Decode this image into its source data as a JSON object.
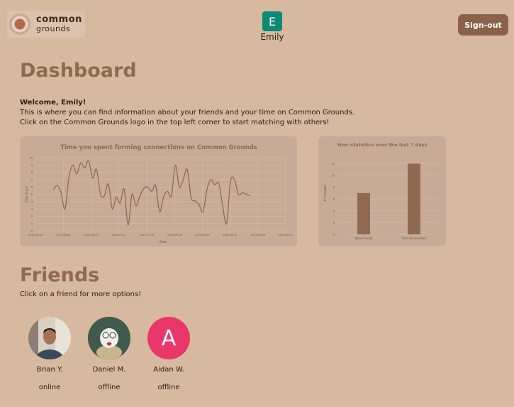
{
  "header": {
    "logo_line1": "common",
    "logo_line2": "grounds",
    "user_initial": "E",
    "user_name": "Emily",
    "signout_label": "Sign-out"
  },
  "dashboard": {
    "title": "Dashboard",
    "welcome_bold": "Welcome, Emily!",
    "line1": "This is where you can find information about your friends and your time on Common Grounds.",
    "line2": "Click on the Common Grounds logo in the top left corner to start matching with others!"
  },
  "friends": {
    "title": "Friends",
    "hint": "Click on a friend for more options!",
    "list": [
      {
        "name": "Brian Y.",
        "status": "online"
      },
      {
        "name": "Daniel M.",
        "status": "offline"
      },
      {
        "name": "Aidan W.",
        "status": "offline",
        "initial": "A"
      }
    ]
  },
  "colors": {
    "background": "#d7b9a0",
    "accent": "#906a50",
    "button": "#8b6148",
    "user_avatar": "#0d8a72",
    "friend_avatar_a": "#e8386a"
  },
  "chart_data": [
    {
      "type": "line",
      "title": "Time you spent forming connections on Common Grounds",
      "xlabel": "Date",
      "ylabel": "Time (mins)",
      "ylim": [
        0,
        10
      ],
      "x_ticks": [
        "2022-05-18",
        "2022-06-05",
        "2022-06-23",
        "2022-07-11",
        "2022-07-29",
        "2022-08-16",
        "2022-09-03",
        "2022-09-21",
        "2022-10-09",
        "2022-10-27"
      ],
      "y_ticks": [
        0,
        1,
        2,
        3,
        4,
        5,
        6,
        7,
        8,
        9,
        10
      ],
      "values": [
        5.6,
        6.2,
        5.2,
        3.0,
        7.3,
        9.0,
        7.8,
        9.3,
        8.6,
        9.6,
        7.2,
        8.4,
        5.0,
        4.8,
        6.4,
        3.0,
        4.6,
        3.8,
        5.7,
        0.8,
        5.0,
        3.4,
        4.8,
        5.8,
        6.0,
        5.4,
        6.2,
        2.6,
        4.6,
        5.4,
        4.8,
        9.0,
        6.0,
        7.0,
        8.4,
        4.5,
        4.1,
        3.6,
        2.6,
        5.6,
        7.0,
        6.3,
        6.5,
        3.4,
        1.0,
        6.8,
        7.0,
        5.0,
        5.2,
        5.0,
        4.8
      ]
    },
    {
      "type": "bar",
      "title": "Your statistics over the last 7 days",
      "ylabel": "# of people",
      "ylim": [
        0,
        13
      ],
      "y_ticks": [
        0,
        2,
        4,
        6,
        8,
        10,
        12
      ],
      "categories": [
        "New Friends",
        "Total Connections"
      ],
      "values": [
        7,
        12
      ]
    }
  ]
}
